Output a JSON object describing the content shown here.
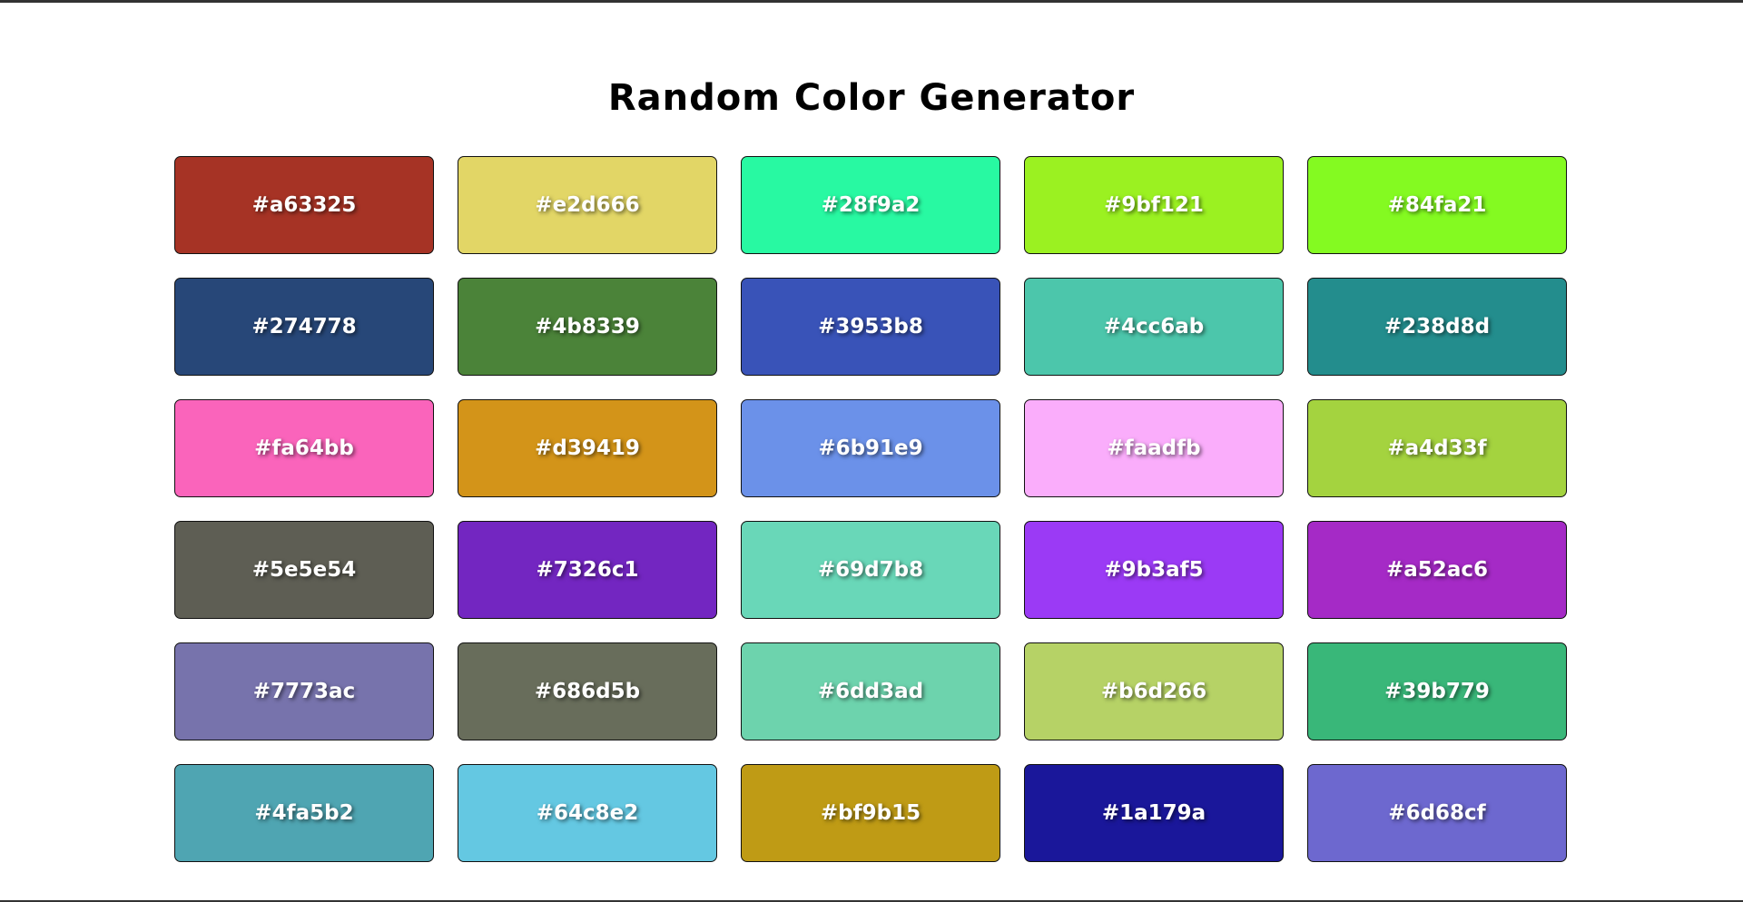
{
  "page": {
    "title": "Random Color Generator"
  },
  "swatches": [
    {
      "hex": "#a63325"
    },
    {
      "hex": "#e2d666"
    },
    {
      "hex": "#28f9a2"
    },
    {
      "hex": "#9bf121"
    },
    {
      "hex": "#84fa21"
    },
    {
      "hex": "#274778"
    },
    {
      "hex": "#4b8339"
    },
    {
      "hex": "#3953b8"
    },
    {
      "hex": "#4cc6ab"
    },
    {
      "hex": "#238d8d"
    },
    {
      "hex": "#fa64bb"
    },
    {
      "hex": "#d39419"
    },
    {
      "hex": "#6b91e9"
    },
    {
      "hex": "#faadfb"
    },
    {
      "hex": "#a4d33f"
    },
    {
      "hex": "#5e5e54"
    },
    {
      "hex": "#7326c1"
    },
    {
      "hex": "#69d7b8"
    },
    {
      "hex": "#9b3af5"
    },
    {
      "hex": "#a52ac6"
    },
    {
      "hex": "#7773ac"
    },
    {
      "hex": "#686d5b"
    },
    {
      "hex": "#6dd3ad"
    },
    {
      "hex": "#b6d266"
    },
    {
      "hex": "#39b779"
    },
    {
      "hex": "#4fa5b2"
    },
    {
      "hex": "#64c8e2"
    },
    {
      "hex": "#bf9b15"
    },
    {
      "hex": "#1a179a"
    },
    {
      "hex": "#6d68cf"
    }
  ]
}
